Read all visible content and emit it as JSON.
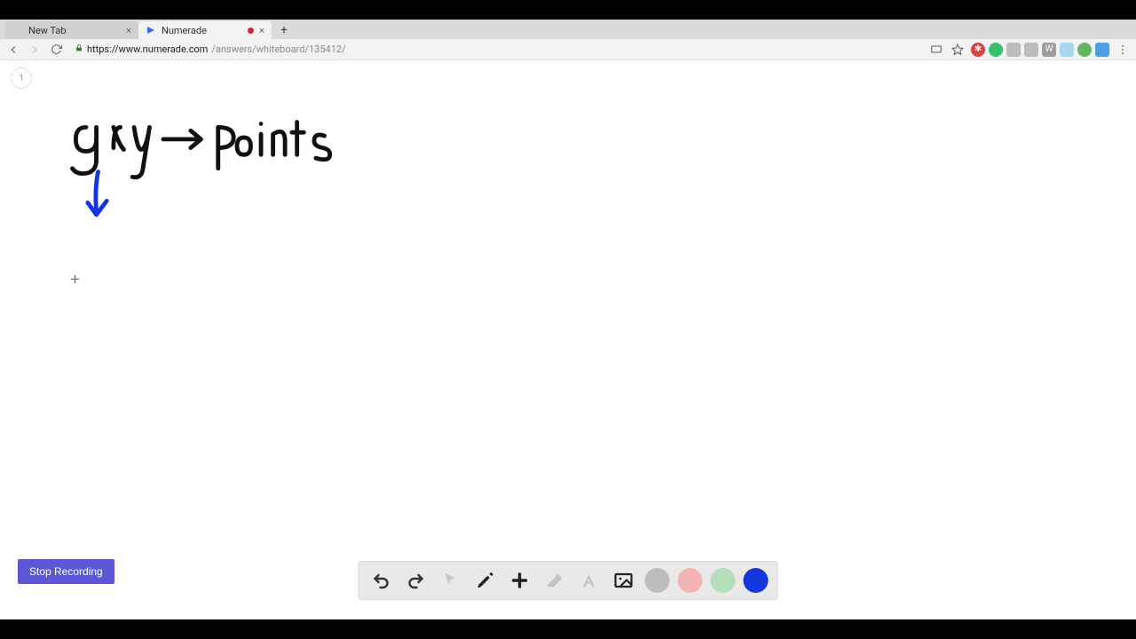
{
  "tabs": [
    {
      "title": "New Tab",
      "active": false
    },
    {
      "title": "Numerade",
      "active": true
    }
  ],
  "url": {
    "host": "https://www.numerade.com",
    "path": "/answers/whiteboard/135412/"
  },
  "page_badge": "1",
  "handwriting": {
    "text1": "gry",
    "text2": "points"
  },
  "stop_recording_label": "Stop Recording",
  "swatches": {
    "grey": "#bdbdbd",
    "pink": "#f3b4b4",
    "green": "#b3e0b8",
    "blue": "#1535e0"
  },
  "extensions": [
    {
      "bg": "#d84343",
      "shape": "circle",
      "glyph": "✱"
    },
    {
      "bg": "#39c06b",
      "shape": "circle",
      "glyph": ""
    },
    {
      "bg": "#bdbdbd",
      "shape": "square",
      "glyph": ""
    },
    {
      "bg": "#bdbdbd",
      "shape": "square",
      "glyph": ""
    },
    {
      "bg": "#9e9e9e",
      "shape": "square",
      "glyph": "W"
    },
    {
      "bg": "#a7d8f0",
      "shape": "square",
      "glyph": ""
    },
    {
      "bg": "#5fb85f",
      "shape": "circle",
      "glyph": ""
    },
    {
      "bg": "#4aa0e8",
      "shape": "square",
      "glyph": ""
    }
  ]
}
